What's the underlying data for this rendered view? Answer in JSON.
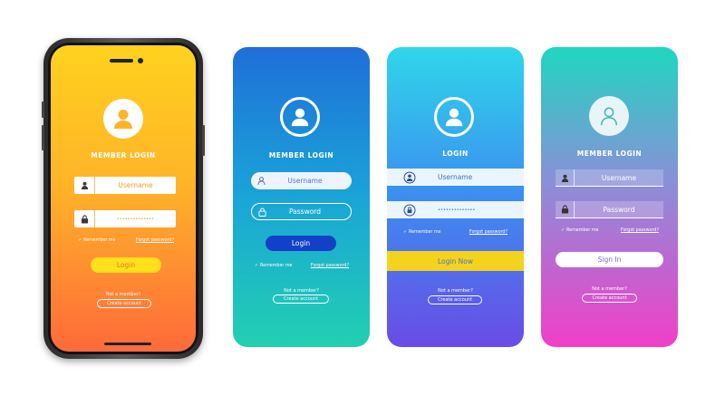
{
  "screens": [
    {
      "title": "MEMBER LOGIN",
      "username_placeholder": "Username",
      "password_value": "••••••••••••••",
      "remember_label": "Remember me",
      "forgot_label": "Forgot password?",
      "button_label": "Login",
      "not_member": "Not a member?",
      "create_account": "Create account",
      "gradient": [
        "#ffd21e",
        "#ff9d2e",
        "#ff5a3c"
      ]
    },
    {
      "title": "MEMBER LOGIN",
      "username_placeholder": "Username",
      "password_placeholder": "Password",
      "button_label": "Login",
      "remember_label": "Remember me",
      "forgot_label": "Forgot password?",
      "not_member": "Not a member?",
      "create_account": "Create account",
      "gradient": [
        "#1f6fd8",
        "#1aa4d8",
        "#22d0b0"
      ]
    },
    {
      "title": "LOGIN",
      "username_placeholder": "Username",
      "password_value": "••••••••••••••",
      "remember_label": "Remember me",
      "forgot_label": "Forgot password?",
      "button_label": "Login Now",
      "not_member": "Not a member?",
      "create_account": "Create account",
      "gradient": [
        "#2fd7ea",
        "#3c8df0",
        "#6b4be6"
      ]
    },
    {
      "title": "MEMBER LOGIN",
      "username_placeholder": "Username",
      "password_placeholder": "Password",
      "remember_label": "Remember me",
      "forgot_label": "Forgot password?",
      "button_label": "Sign In",
      "not_member": "Not a member?",
      "create_account": "Create account",
      "gradient": [
        "#1fd7c0",
        "#8a8fd8",
        "#f23fc8"
      ]
    }
  ]
}
